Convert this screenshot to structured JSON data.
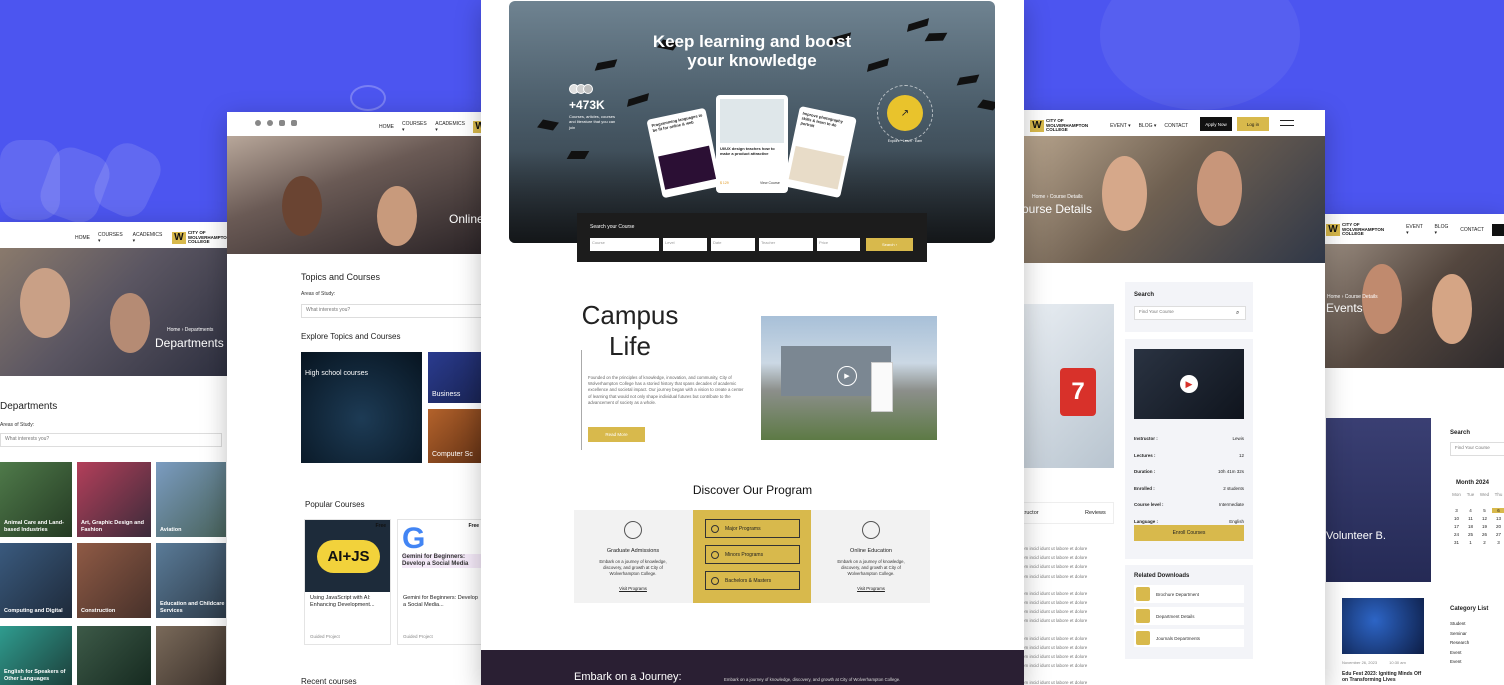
{
  "hero": {
    "title_line1": "Keep learning and boost",
    "title_line2": "your knowledge",
    "stat": "+473K",
    "stat_caption": "Courses, articles, courses and literature that you can join",
    "badge": "Explore · Learn · Earn",
    "cards": [
      {
        "title": "Programming languages to be fit for online & web"
      },
      {
        "title": "UI/UX design teaches how to make a product attractive",
        "price": "$ 129",
        "action": "View Course"
      },
      {
        "title": "Improve photography skills & learn to do portrait"
      }
    ],
    "search": {
      "label": "Search your Course",
      "fields": [
        "Course",
        "Level",
        "Date",
        "Teacher",
        "Price"
      ],
      "button": "Search ›"
    }
  },
  "campus": {
    "title_line1": "Campus",
    "title_line2": "Life",
    "body": "Founded on the principles of knowledge, innovation, and community, City of Wolverhampton College has a storied history that spans decades of academic excellence and societal impact. Our journey began with a vision to create a center of learning that would not only shape individual futures but contribute to the advancement of society as a whole.",
    "button": "Read More"
  },
  "program": {
    "title": "Discover Our Program",
    "left": {
      "title": "Graduate Admissions",
      "body": "Embark on a journey of knowledge, discovery, and growth at City of Wolverhampton College.",
      "link": "Visit Programs"
    },
    "middle": [
      "Major Programs",
      "Minors Programs",
      "Bachelors & Masters"
    ],
    "right": {
      "title": "Online Education",
      "body": "Embark on a journey of knowledge, discovery, and growth at City of Wolverhampton College.",
      "link": "Visit Programs"
    }
  },
  "footer": {
    "title": "Embark on a Journey:",
    "body": "Embark on a journey of knowledge, discovery, and growth at City of Wolverhampton College."
  },
  "logo": {
    "line1": "CITY OF",
    "line2": "WOLVERHAMPTON",
    "line3": "COLLEGE"
  },
  "nav": {
    "home": "HOME",
    "courses": "COURSES ▾",
    "academics": "ACADEMICS ▾",
    "event": "EVENT ▾",
    "blog": "BLOG ▾",
    "contact": "CONTACT",
    "apply": "Apply Now",
    "login": "Log in"
  },
  "deptPage": {
    "breadcrumb": "Home  ›  Departments",
    "hero_title": "Departments",
    "heading": "Departments",
    "label": "Areas of Study:",
    "placeholder": "What interests you?",
    "items": [
      "Animal Care and Land-based Industries",
      "Art, Graphic Design and Fashion",
      "Aviation",
      "Computing and Digital",
      "Construction",
      "Education and Childcare Services",
      "English for Speakers of Other Languages",
      "",
      ""
    ]
  },
  "topicsPage": {
    "hero_title": "Online",
    "heading": "Topics and Courses",
    "label": "Areas of Study:",
    "placeholder": "What interests you?",
    "explore": "Explore Topics and Courses",
    "tiles": [
      "High school courses",
      "Business",
      "Computer Sc"
    ],
    "popular": "Popular Courses",
    "recent": "Recent courses",
    "courses": [
      {
        "tag": "Free",
        "title": "Using JavaScript with AI: Enhancing Development...",
        "meta": "Guided Project",
        "thumb": "AI+JS"
      },
      {
        "tag": "Free",
        "title": "Gemini for Beginners: Develop a Social Media...",
        "meta": "Guided Project",
        "thumb": "Gemini for Beginners: Develop a Social Media"
      }
    ]
  },
  "detailPage": {
    "breadcrumb": "Home  ›  Course Details",
    "hero_title": "ourse Details",
    "search": "Search",
    "search_placeholder": "Find Your Course",
    "rows": [
      [
        "Instructor :",
        "Lewis"
      ],
      [
        "Lectures :",
        "12"
      ],
      [
        "Duration :",
        "10h 41m 32s"
      ],
      [
        "Enrolled :",
        "2 students"
      ],
      [
        "Course level :",
        "Intermediate"
      ],
      [
        "Language :",
        "English"
      ]
    ],
    "enroll": "Enroll Courses",
    "related": "Related Downloads",
    "downloads": [
      "Brochure Department",
      "Department Details",
      "Journals Departments"
    ],
    "tabs": [
      "tructor",
      "Reviews"
    ],
    "lorem": "em incid idunt ut labore et dolore"
  },
  "eventsPage": {
    "breadcrumb": "Home  ›  Course Details",
    "hero_title": "Events",
    "card_title": "Volunteer B.",
    "search": "Search",
    "search_placeholder": "Find Your Course",
    "month": "Month 2024",
    "weekdays": [
      "Mon",
      "Tue",
      "Wed",
      "Thu",
      "Fri",
      "Sat",
      "Sun"
    ],
    "days": [
      "",
      "",
      "",
      "",
      "",
      "1",
      "2",
      "3",
      "4",
      "5",
      "6",
      "7",
      "8",
      "9",
      "10",
      "11",
      "12",
      "13",
      "14",
      "15",
      "16",
      "17",
      "18",
      "19",
      "20",
      "21",
      "22",
      "23",
      "24",
      "25",
      "26",
      "27",
      "28",
      "29",
      "30",
      "31",
      "1",
      "2",
      "3",
      "4"
    ],
    "categories_title": "Category List",
    "categories": [
      "Student",
      "Seminar",
      "Research",
      "Event",
      "Event"
    ],
    "event_date": "November 26, 2023",
    "event_time": "10:30 am",
    "event_title": "Edu Fest 2023: Igniting Minds Off on Transforming Lives"
  }
}
